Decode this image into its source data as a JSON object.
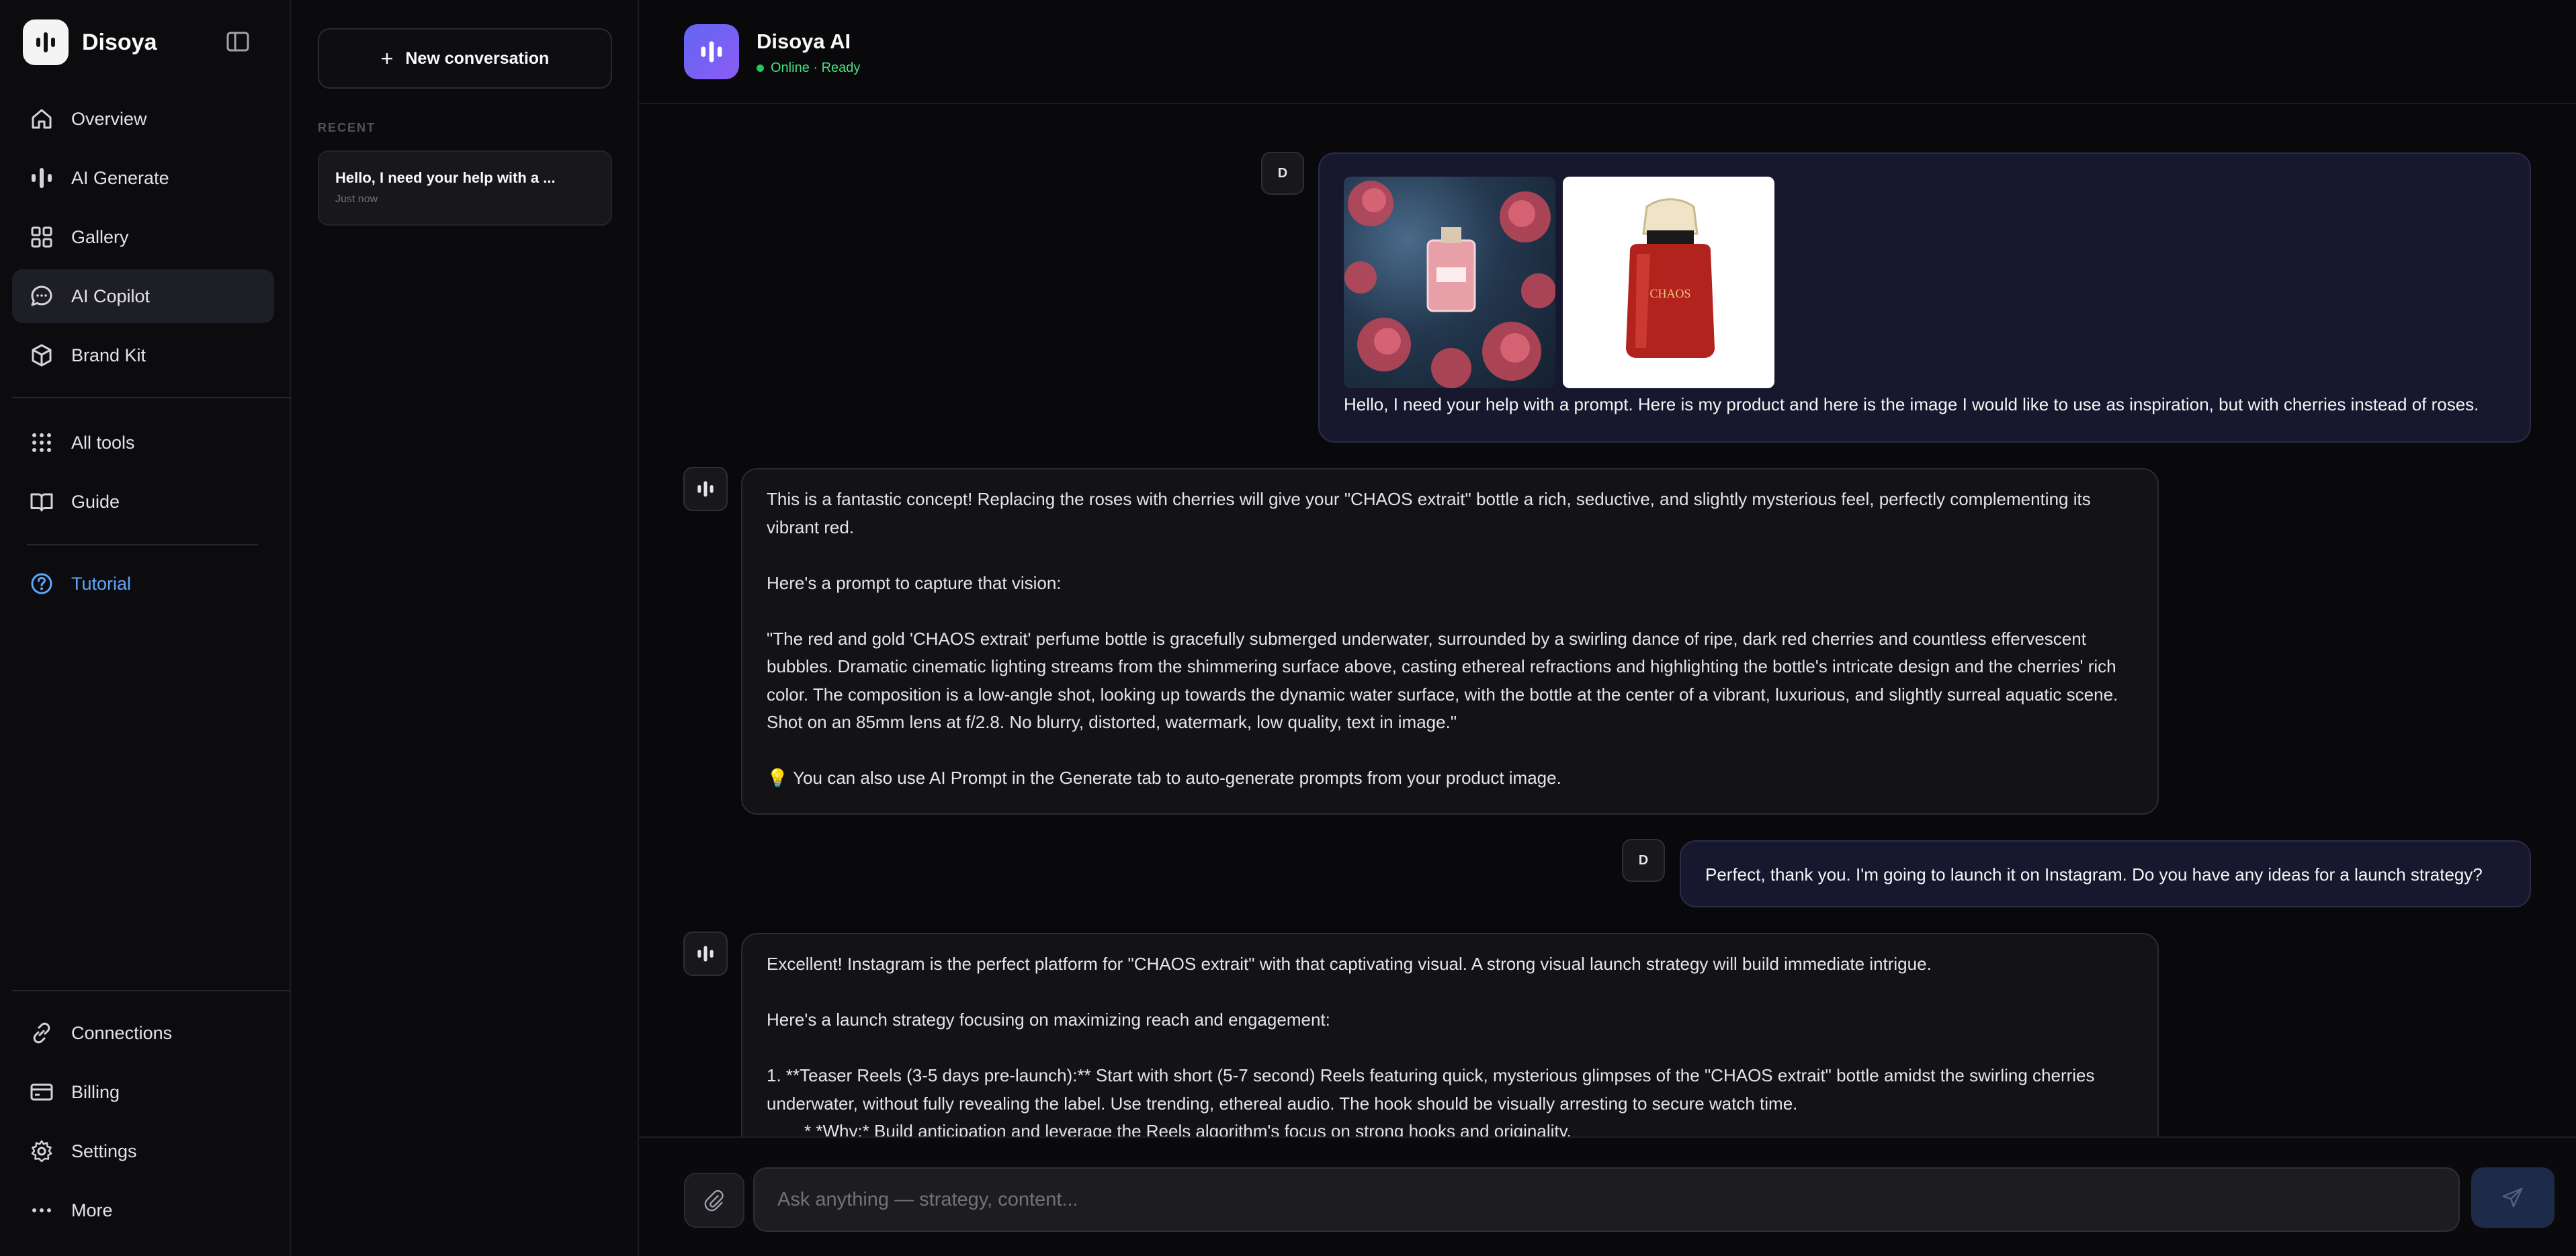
{
  "brand": {
    "name": "Disoya"
  },
  "nav": {
    "main": [
      {
        "label": "Overview",
        "icon": "home-icon"
      },
      {
        "label": "AI Generate",
        "icon": "waveform-icon"
      },
      {
        "label": "Gallery",
        "icon": "grid-icon"
      },
      {
        "label": "AI Copilot",
        "icon": "chat-icon",
        "active": true
      },
      {
        "label": "Brand Kit",
        "icon": "box-icon"
      }
    ],
    "tools": [
      {
        "label": "All tools",
        "icon": "dots-grid-icon"
      },
      {
        "label": "Guide",
        "icon": "book-icon"
      }
    ],
    "tutorial": {
      "label": "Tutorial",
      "icon": "help-circle-icon"
    },
    "bottom": [
      {
        "label": "Connections",
        "icon": "link-icon"
      },
      {
        "label": "Billing",
        "icon": "credit-card-icon"
      },
      {
        "label": "Settings",
        "icon": "gear-icon"
      },
      {
        "label": "More",
        "icon": "more-horizontal-icon"
      }
    ]
  },
  "conversations": {
    "new_label": "New conversation",
    "recent_label": "RECENT",
    "items": [
      {
        "title": "Hello, I need your help with a ...",
        "time": "Just now"
      }
    ]
  },
  "header": {
    "title": "Disoya AI",
    "status": "Online · Ready"
  },
  "messages": {
    "user_initial": "D",
    "m1_user": "Hello, I need your help with a prompt. Here is my product and here is the image I would like to use as inspiration, but with cherries instead of roses.",
    "m2_ai": {
      "p1": "This is a fantastic concept! Replacing the roses with cherries will give your \"CHAOS extrait\" bottle a rich, seductive, and slightly mysterious feel, perfectly complementing its vibrant red.",
      "p2": "Here's a prompt to capture that vision:",
      "p3": "\"The red and gold 'CHAOS extrait' perfume bottle is gracefully submerged underwater, surrounded by a swirling dance of ripe, dark red cherries and countless effervescent bubbles. Dramatic cinematic lighting streams from the shimmering surface above, casting ethereal refractions and highlighting the bottle's intricate design and the cherries' rich color. The composition is a low-angle shot, looking up towards the dynamic water surface, with the bottle at the center of a vibrant, luxurious, and slightly surreal aquatic scene. Shot on an 85mm lens at f/2.8. No blurry, distorted, watermark, low quality, text in image.\"",
      "p4": "💡 You can also use AI Prompt in the Generate tab to auto-generate prompts from your product image."
    },
    "m3_user": "Perfect, thank you. I'm going to launch it on Instagram. Do you have any ideas for a launch strategy?",
    "m4_ai": {
      "p1": "Excellent! Instagram is the perfect platform for \"CHAOS extrait\" with that captivating visual. A strong visual launch strategy will build immediate intrigue.",
      "p2": "Here's a launch strategy focusing on maximizing reach and engagement:",
      "p3": "1.  **Teaser Reels (3-5 days pre-launch):** Start with short (5-7 second) Reels featuring quick, mysterious glimpses of the \"CHAOS extrait\" bottle amidst the swirling cherries underwater, without fully revealing the label. Use trending, ethereal audio. The hook should be visually arresting to secure watch time.",
      "p4": "*   *Why:* Build anticipation and leverage the Reels algorithm's focus on strong hooks and originality."
    },
    "product_label": "CHAOS"
  },
  "composer": {
    "placeholder": "Ask anything — strategy, content..."
  }
}
